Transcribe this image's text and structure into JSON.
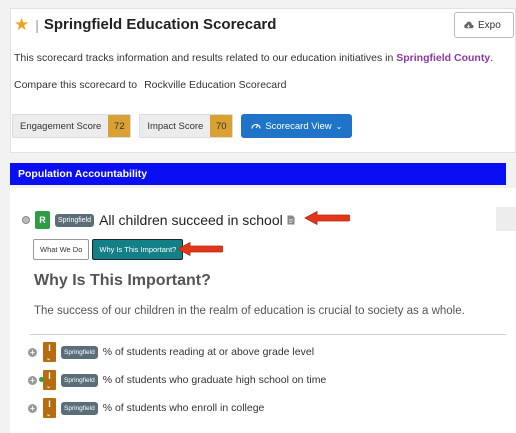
{
  "header": {
    "title": "Springfield Education Scorecard",
    "export_label": "Expo",
    "description_before": "This scorecard tracks information and results related to our education initiatives in ",
    "description_county": "Springfield County",
    "description_after": ".",
    "compare_label": "Compare this scorecard to",
    "compare_link": "Rockville Education Scorecard"
  },
  "scores": {
    "engagement_label": "Engagement Score",
    "engagement_value": "72",
    "impact_label": "Impact Score",
    "impact_value": "70",
    "scorecard_view_label": "Scorecard View"
  },
  "section": {
    "title": "Population Accountability"
  },
  "objective": {
    "status_badge": "R",
    "location_badge": "Springfield",
    "title": "All children succeed in school",
    "tabs": {
      "what_we_do": "What We Do",
      "why_important": "Why Is This Important?"
    },
    "why_heading": "Why Is This Important?",
    "why_text": "The success of our children in the realm of education is crucial to society as a whole."
  },
  "measures": [
    {
      "badge": "I",
      "location": "Springfield",
      "text": "% of students reading at or above grade level"
    },
    {
      "badge": "I",
      "location": "Springfield",
      "text": "% of students who graduate high school on time"
    },
    {
      "badge": "I",
      "location": "Springfield",
      "text": "% of students who enroll in college"
    }
  ],
  "colors": {
    "section_bar": "#0a0ef2",
    "score_value": "#d9a032",
    "status_green": "#2e9c42",
    "indicator_brown": "#b76d0f",
    "active_tab": "#137f86",
    "arrow_red": "#e0361a"
  }
}
